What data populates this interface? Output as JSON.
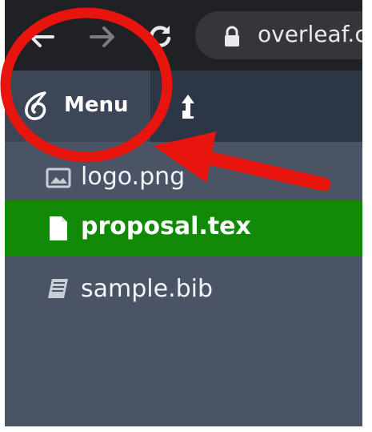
{
  "browser": {
    "url": "overleaf.c",
    "back_icon": "back-arrow-icon",
    "forward_icon": "forward-arrow-icon",
    "reload_icon": "reload-icon",
    "lock_icon": "lock-icon"
  },
  "toolbar": {
    "menu_label": "Menu",
    "logo_icon": "overleaf-logo-icon",
    "upload_icon": "upload-icon"
  },
  "file_tree": {
    "files": [
      {
        "name": "logo.png",
        "icon": "image-file-icon",
        "selected": false
      },
      {
        "name": "proposal.tex",
        "icon": "document-file-icon",
        "selected": true
      },
      {
        "name": "sample.bib",
        "icon": "book-file-icon",
        "selected": false
      }
    ]
  },
  "colors": {
    "browser_bar": "#202124",
    "toolbar": "#2c3645",
    "menu_button": "#3c4656",
    "file_tree_bg": "#4a5465",
    "selected_row": "#138a07",
    "annotation": "#e8140e"
  }
}
